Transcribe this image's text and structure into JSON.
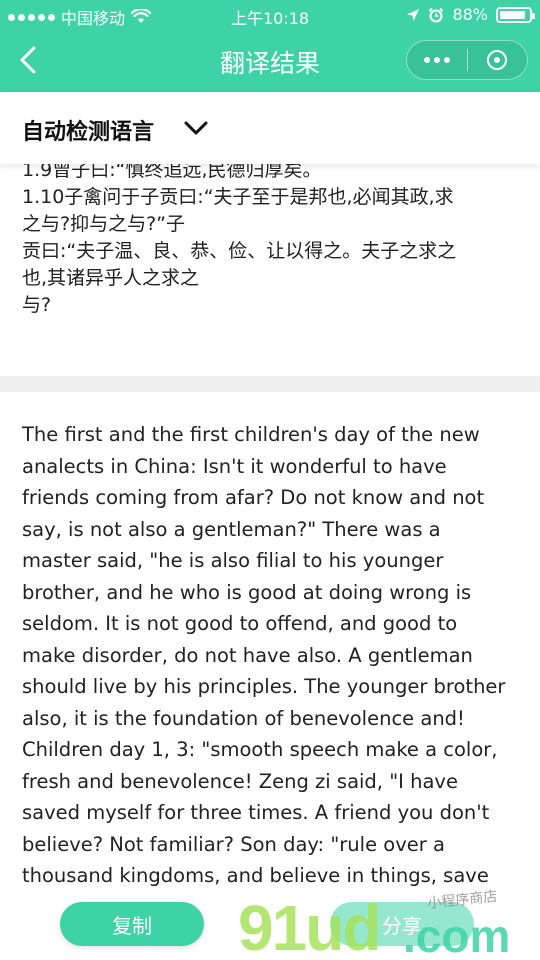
{
  "status_bar": {
    "carrier": "中国移动",
    "time": "上午10:18",
    "battery": "88%",
    "battery_level": 0.88
  },
  "nav": {
    "title": "翻译结果"
  },
  "language": {
    "label": "自动检测语言"
  },
  "source_lines": [
    "1.9曾子曰:“慎终追远,民德归厚矣。",
    "1.10子禽问于子贡曰:“夫子至于是邦也,必闻其政,求",
    "之与?抑与之与?”子",
    "贡曰:“夫子温、良、恭、俭、让以得之。夫子之求之",
    "也,其诸异乎人之求之",
    "与?"
  ],
  "translation_lines": [
    "The first and the first children's day of the new",
    "analects in China: Isn't it wonderful to have",
    "friends coming from afar? Do not know and not",
    "say, is not also a gentleman?\" There was a",
    "master said, \"he is also filial to his younger",
    "brother, and he who is good at doing wrong is",
    "seldom. It is not good to offend, and good to",
    "make disorder, do not have also. A gentleman",
    "should live by his principles. The younger brother",
    "also, it is the foundation of benevolence and!",
    "Children day 1, 3: \"smooth speech make a color,",
    "fresh and benevolence! Zeng zi said, \"I have",
    "saved myself for three times. A friend you don't",
    "believe? Not familiar? Son day: \"rule over a",
    "thousand kingdoms, and believe in things, save"
  ],
  "buttons": {
    "copy": "复制",
    "share": "分享"
  },
  "watermark": {
    "brand": "91ud.com",
    "tagline": "小程序商店"
  },
  "colors": {
    "accent": "#3ed3a4"
  }
}
